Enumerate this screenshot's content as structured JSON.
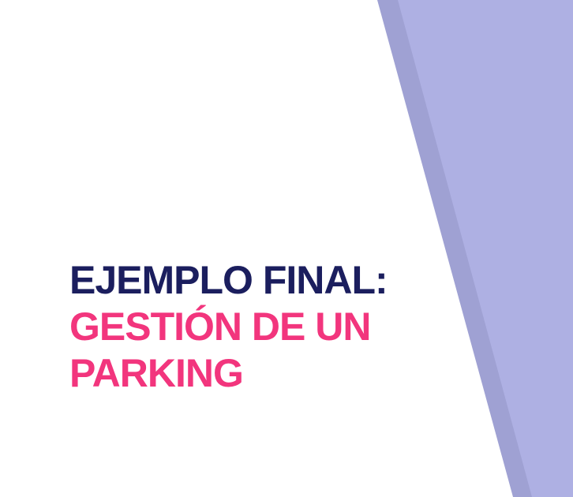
{
  "slide": {
    "title_line_1": "EJEMPLO FINAL:",
    "title_line_2": "GESTIÓN DE UN",
    "title_line_3": "PARKING"
  },
  "colors": {
    "background": "#ffffff",
    "title_primary": "#1b1e5e",
    "title_accent": "#f2357d",
    "panel_light": "#aeb0e3",
    "panel_shadow": "#9fa1d3"
  }
}
